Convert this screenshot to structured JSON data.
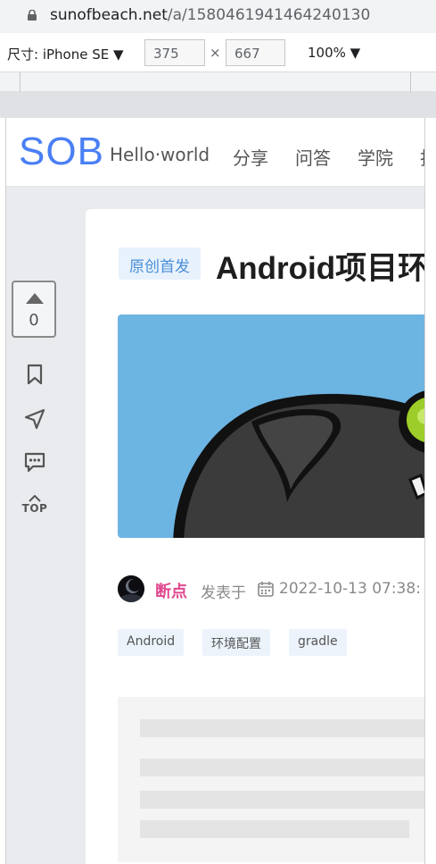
{
  "browser": {
    "url_host": "sunofbeach.net",
    "url_path": "/a/1580461941464240130"
  },
  "devtools": {
    "size_label": "尺寸: iPhone SE ▼",
    "width": "375",
    "times": "×",
    "height": "667",
    "zoom": "100% ▼"
  },
  "site": {
    "logo": "SOB",
    "nav": [
      "Hello·world",
      "分享",
      "问答",
      "学院",
      "找"
    ]
  },
  "sidebar": {
    "like_count": "0",
    "top_label": "TOP"
  },
  "article": {
    "badge": "原创首发",
    "title": "Android项目环境配置",
    "author": "断点",
    "published_prefix": "发表于",
    "date": "2022-10-13 07:38:",
    "tags": [
      "Android",
      "环境配置",
      "gradle"
    ]
  },
  "colors": {
    "logo": "#4a7ff5",
    "author": "#e0488e",
    "badge_bg": "#e8f2fd",
    "badge_text": "#4a8fd6",
    "cover_bg": "#6cb4e2"
  }
}
